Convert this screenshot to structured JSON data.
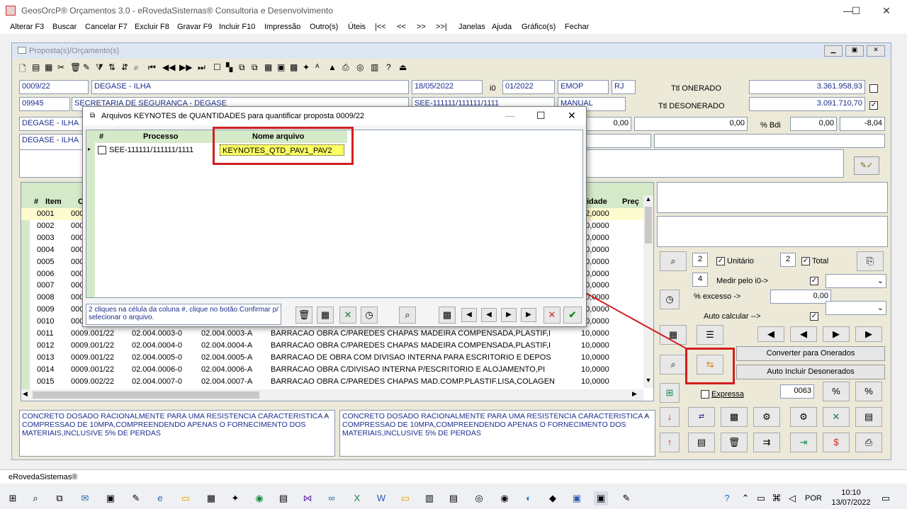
{
  "window": {
    "title": "GeosOrcP® Orçamentos 3.0 - eRovedaSistemas® Consultoria e Desenvolvimento"
  },
  "menu": [
    "Alterar F3",
    "Buscar",
    "Cancelar F7",
    "Excluir F8",
    "Gravar F9",
    "Incluir F10",
    "Impressão",
    "Outro(s)",
    "Úteis",
    "|<<",
    "<<",
    ">>",
    ">>|",
    "Janelas",
    "Ajuda",
    "Gráfico(s)",
    "Fechar"
  ],
  "mdi": {
    "title": "Proposta(s)/Orçamento(s)"
  },
  "form": {
    "proposta": "0009/22",
    "cliente": "DEGASE - ILHA",
    "data": "18/05/2022",
    "i0_label": "i0",
    "i0": "01/2022",
    "fonte": "EMOP",
    "uf": "RJ",
    "codigo": "09945",
    "orgao": "SECRETARIA DE SEGURANCA - DEGASE",
    "processo": "SEE-111111/111111/1111",
    "tipo": "MANUAL",
    "local1": "DEGASE - ILHA",
    "local2": "DEGASE - ILHA",
    "val1": "0,00",
    "val2": "0,00",
    "bdi_label": "% Bdi",
    "bdi1": "0,00",
    "bdi2": "-8,04",
    "slash": "/",
    "ttl_onerado_label": "Ttl ONERADO",
    "ttl_onerado": "3.361.958,93",
    "ttl_desonerado_label": "Ttl DESONERADO",
    "ttl_desonerado": "3.091.710,70"
  },
  "grid": {
    "headers": {
      "hash": "#",
      "item": "Item",
      "o": "O",
      "qtd": "idade",
      "preco": "Preç"
    },
    "rows": [
      {
        "item": "0001",
        "c1": "000",
        "c2": "",
        "c3": "",
        "desc": "",
        "qtd": "12,0000"
      },
      {
        "item": "0002",
        "c1": "000",
        "c2": "",
        "c3": "",
        "desc": "",
        "qtd": "10,0000"
      },
      {
        "item": "0003",
        "c1": "000",
        "c2": "",
        "c3": "",
        "desc": "",
        "qtd": "10,0000"
      },
      {
        "item": "0004",
        "c1": "000",
        "c2": "",
        "c3": "",
        "desc": "",
        "qtd": "10,0000"
      },
      {
        "item": "0005",
        "c1": "000",
        "c2": "",
        "c3": "",
        "desc": "",
        "qtd": "10,0000"
      },
      {
        "item": "0006",
        "c1": "000",
        "c2": "",
        "c3": "",
        "desc": "",
        "qtd": "10,0000"
      },
      {
        "item": "0007",
        "c1": "000",
        "c2": "",
        "c3": "",
        "desc": "",
        "qtd": "10,0000"
      },
      {
        "item": "0008",
        "c1": "000",
        "c2": "",
        "c3": "",
        "desc": "",
        "qtd": "10,0000"
      },
      {
        "item": "0009",
        "c1": "000",
        "c2": "",
        "c3": "",
        "desc": "",
        "qtd": "10,0000"
      },
      {
        "item": "0010",
        "c1": "000",
        "c2": "",
        "c3": "",
        "desc": "",
        "qtd": "10,0000"
      },
      {
        "item": "0011",
        "c1": "0009.001/22",
        "c2": "02.004.0003-0",
        "c3": "02.004.0003-A",
        "desc": "BARRACAO OBRA C/PAREDES CHAPAS MADEIRA COMPENSADA,PLASTIF,I",
        "qtd": "10,0000"
      },
      {
        "item": "0012",
        "c1": "0009.001/22",
        "c2": "02.004.0004-0",
        "c3": "02.004.0004-A",
        "desc": "BARRACAO OBRA C/PAREDES CHAPAS MADEIRA COMPENSADA,PLASTIF,I",
        "qtd": "10,0000"
      },
      {
        "item": "0013",
        "c1": "0009.001/22",
        "c2": "02.004.0005-0",
        "c3": "02.004.0005-A",
        "desc": "BARRACAO DE OBRA COM DIVISAO INTERNA PARA ESCRITORIO E DEPOS",
        "qtd": "10,0000"
      },
      {
        "item": "0014",
        "c1": "0009.001/22",
        "c2": "02.004.0006-0",
        "c3": "02.004.0006-A",
        "desc": "BARRACAO OBRA C/DIVISAO INTERNA P/ESCRITORIO E ALOJAMENTO,PI",
        "qtd": "10,0000"
      },
      {
        "item": "0015",
        "c1": "0009.002/22",
        "c2": "02.004.0007-0",
        "c3": "02.004.0007-A",
        "desc": "BARRACAO OBRA C/PAREDES CHAPAS MAD.COMP.PLASTIF.LISA,COLAGEN",
        "qtd": "10,0000"
      },
      {
        "item": "0016",
        "c1": "0009.002/22",
        "c2": "02.004.0010-0",
        "c3": "02.004.0010-A",
        "desc": "BARRACAO DE OBRA EM CHAPA DE MADEIRA COMPENSADA DE 6MM DE E",
        "qtd": "10,0000"
      }
    ]
  },
  "memo": "CONCRETO DOSADO RACIONALMENTE PARA UMA RESISTENCIA CARACTERISTICA A COMPRESSAO DE 10MPA,COMPREENDENDO APENAS O FORNECIMENTO DOS MATERIAIS,INCLUSIVE 5% DE PERDAS",
  "right": {
    "n1": "2",
    "unitario": "Unitário",
    "n2": "2",
    "total": "Total",
    "n3": "4",
    "medir": "Medir pelo i0->",
    "excesso": "% excesso ->",
    "excesso_val": "0,00",
    "auto_calc": "Auto calcular -->",
    "converter": "Converter para Onerados",
    "auto_incluir": "Auto Incluir Desonerados",
    "expressa": "Expressa",
    "cod": "0063"
  },
  "dialog": {
    "title": "Arquivos KEYNOTES de QUANTIDADES para quantificar proposta 0009/22",
    "col_hash": "#",
    "col_processo": "Processo",
    "col_nome": "Nome arquivo",
    "row_processo": "SEE-111111/111111/1111",
    "row_nome": "KEYNOTES_QTD_PAV1_PAV2",
    "hint": "2 cliques na célula da coluna #, clique no botão Confirmar p/ selecionar o arquivo."
  },
  "status": "eRovedaSistemas®",
  "taskbar": {
    "lang": "POR",
    "time": "10:10",
    "date": "13/07/2022"
  }
}
